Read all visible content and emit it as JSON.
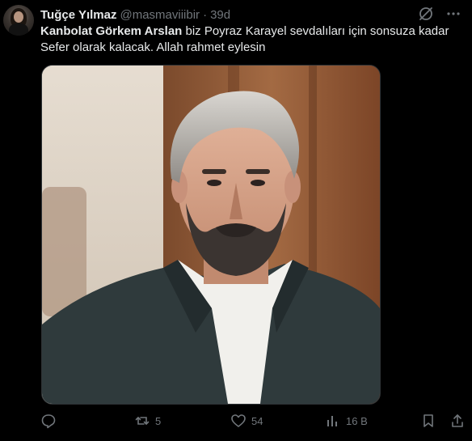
{
  "author": {
    "name": "Tuğçe Yılmaz",
    "handle": "@masmaviiibir",
    "separator": "·",
    "time": "39d"
  },
  "post": {
    "mention": "Kanbolat Görkem Arslan",
    "text": " biz Poyraz Karayel sevdalıları için sonsuza kadar Sefer olarak kalacak. Allah rahmet eylesin"
  },
  "metrics": {
    "reposts": "5",
    "likes": "54",
    "views": "16 B"
  },
  "icons": {
    "grok": "grok-icon",
    "more": "more-icon",
    "reply": "reply-icon",
    "repost": "repost-icon",
    "like": "heart-icon",
    "views": "views-icon",
    "bookmark": "bookmark-icon"
  },
  "colors": {
    "background": "#000000",
    "text": "#e7e9ea",
    "muted": "#71767b",
    "border": "#2f3336"
  }
}
